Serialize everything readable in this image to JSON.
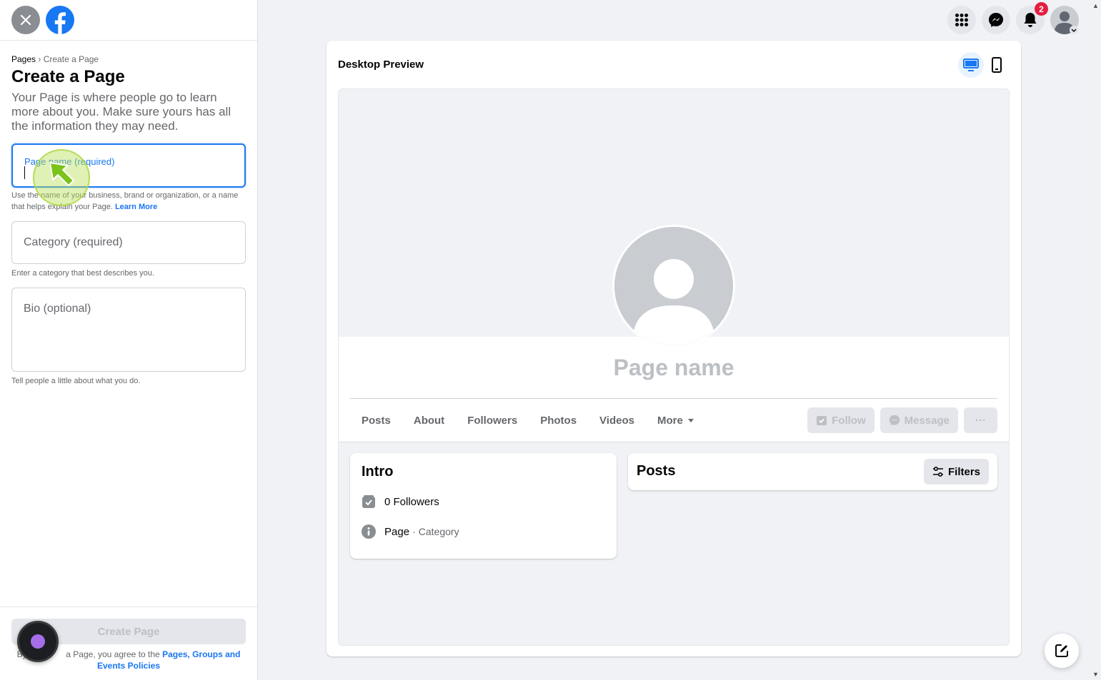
{
  "sidebar": {
    "breadcrumb": {
      "root": "Pages",
      "separator": "›",
      "current": "Create a Page"
    },
    "title": "Create a Page",
    "description": "Your Page is where people go to learn more about you. Make sure yours has all the information they may need.",
    "page_name": {
      "placeholder": "Page name (required)",
      "value": ""
    },
    "page_name_hint": "Use the name of your business, brand or organization, or a name that helps explain your Page.",
    "learn_more": "Learn More",
    "category": {
      "placeholder": "Category (required)"
    },
    "category_hint": "Enter a category that best describes you.",
    "bio": {
      "placeholder": "Bio (optional)"
    },
    "bio_hint": "Tell people a little about what you do.",
    "create_button": "Create Page",
    "agree_prefix": "By",
    "agree_middle": "a Page, you agree to the",
    "agree_link": "Pages, Groups and Events Policies"
  },
  "header": {
    "notification_count": "2"
  },
  "preview": {
    "title": "Desktop Preview",
    "page_name": "Page name",
    "tabs": [
      "Posts",
      "About",
      "Followers",
      "Photos",
      "Videos",
      "More"
    ],
    "actions": {
      "follow": "Follow",
      "message": "Message",
      "more": "···"
    },
    "intro": {
      "title": "Intro",
      "followers": "0 Followers",
      "page_label": "Page",
      "category_label": "· Category"
    },
    "posts": {
      "title": "Posts",
      "filters": "Filters"
    }
  },
  "colors": {
    "accent": "#1877f2",
    "badge": "#e41e3f"
  }
}
